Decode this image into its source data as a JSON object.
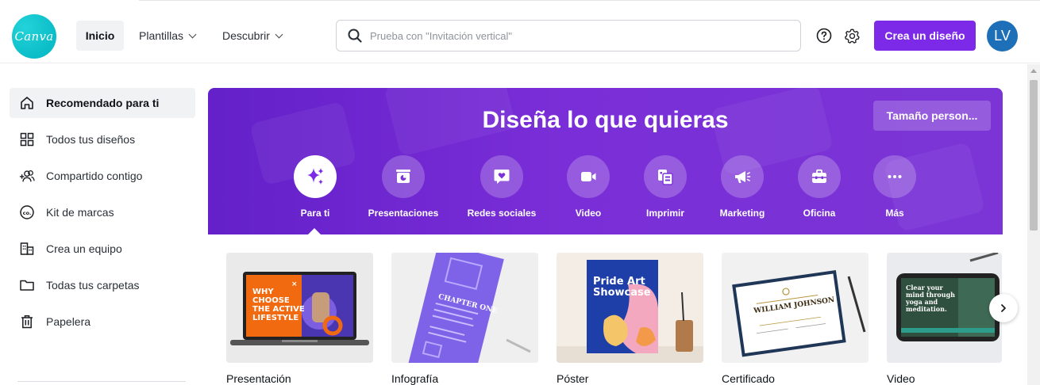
{
  "header": {
    "logo_text": "Canva",
    "home_label": "Inicio",
    "templates_label": "Plantillas",
    "discover_label": "Descubrir",
    "search_placeholder": "Prueba con \"Invitación vertical\"",
    "create_button": "Crea un diseño",
    "avatar_initials": "LV",
    "accent_color": "#7d2ae8"
  },
  "sidebar": {
    "items": [
      {
        "label": "Recomendado para ti",
        "icon": "home-icon",
        "active": true
      },
      {
        "label": "Todos tus diseños",
        "icon": "grid-icon",
        "active": false
      },
      {
        "label": "Compartido contigo",
        "icon": "shared-users-icon",
        "active": false
      },
      {
        "label": "Kit de marcas",
        "icon": "brand-kit-icon",
        "active": false
      },
      {
        "label": "Crea un equipo",
        "icon": "team-building-icon",
        "active": false
      },
      {
        "label": "Todas tus carpetas",
        "icon": "folder-icon",
        "active": false
      },
      {
        "label": "Papelera",
        "icon": "trash-icon",
        "active": false
      }
    ]
  },
  "hero": {
    "title": "Diseña lo que quieras",
    "custom_size_button": "Tamaño person...",
    "categories": [
      {
        "label": "Para ti",
        "icon": "sparkle-icon",
        "active": true
      },
      {
        "label": "Presentaciones",
        "icon": "presentation-icon",
        "active": false
      },
      {
        "label": "Redes sociales",
        "icon": "heart-chat-icon",
        "active": false
      },
      {
        "label": "Video",
        "icon": "video-camera-icon",
        "active": false
      },
      {
        "label": "Imprimir",
        "icon": "print-icon",
        "active": false
      },
      {
        "label": "Marketing",
        "icon": "megaphone-icon",
        "active": false
      },
      {
        "label": "Oficina",
        "icon": "briefcase-icon",
        "active": false
      },
      {
        "label": "Más",
        "icon": "more-dots-icon",
        "active": false
      }
    ]
  },
  "cards": [
    {
      "label": "Presentación",
      "thumb_text": "WHY CHOOSE THE ACTIVE LIFESTYLE"
    },
    {
      "label": "Infografía",
      "thumb_text": "CHAPTER ONE"
    },
    {
      "label": "Póster",
      "thumb_text": "Pride Art Showcase"
    },
    {
      "label": "Certificado",
      "thumb_text": "WILLIAM JOHNSON"
    },
    {
      "label": "Video",
      "thumb_text": "Clear your mind through yoga and meditation."
    }
  ]
}
